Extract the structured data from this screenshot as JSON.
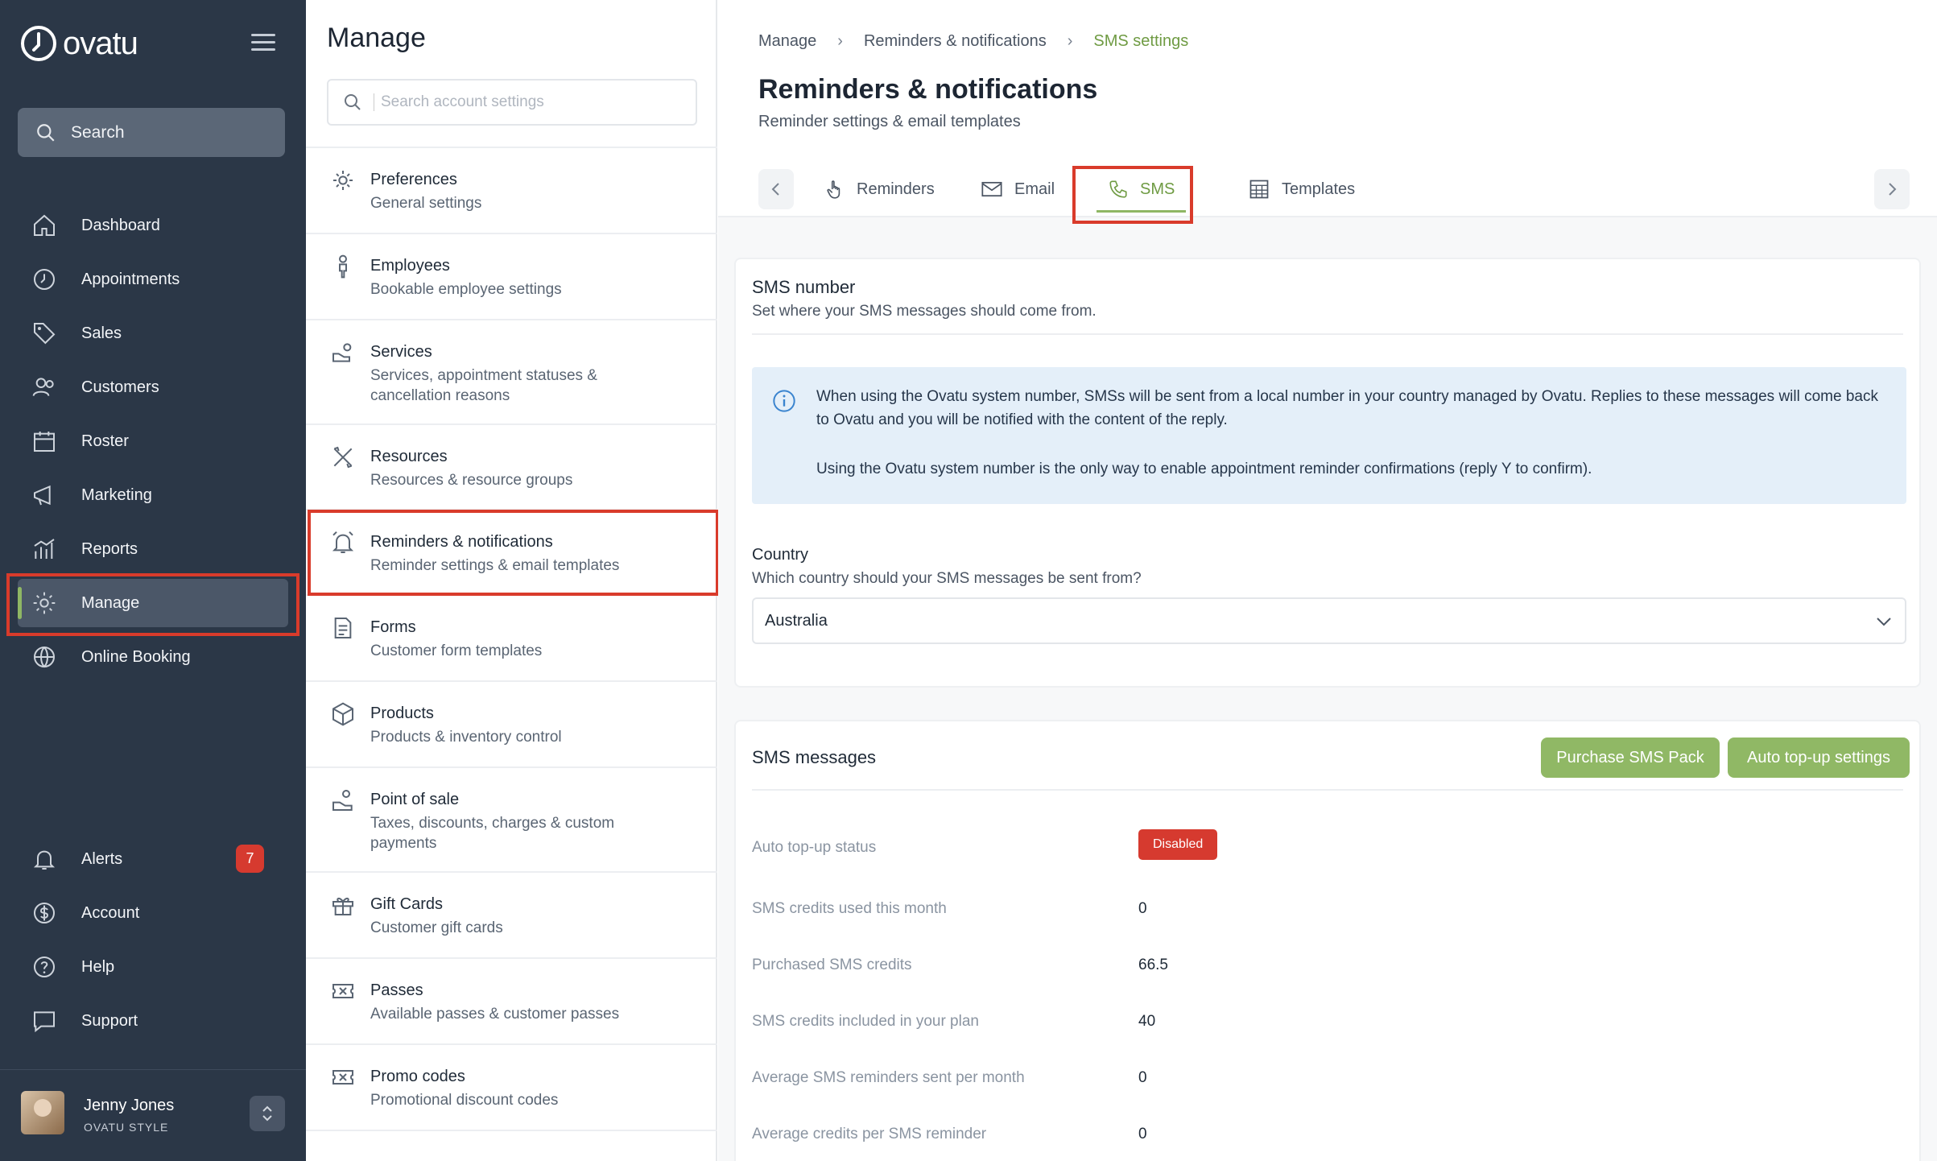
{
  "app": {
    "name": "ovatu"
  },
  "sidebar": {
    "search_label": "Search",
    "items": [
      {
        "label": "Dashboard",
        "icon": "home-icon"
      },
      {
        "label": "Appointments",
        "icon": "clock-icon"
      },
      {
        "label": "Sales",
        "icon": "tag-icon"
      },
      {
        "label": "Customers",
        "icon": "users-icon"
      },
      {
        "label": "Roster",
        "icon": "calendar-icon"
      },
      {
        "label": "Marketing",
        "icon": "megaphone-icon"
      },
      {
        "label": "Reports",
        "icon": "chart-icon"
      },
      {
        "label": "Manage",
        "icon": "gear-icon",
        "active": true
      },
      {
        "label": "Online Booking",
        "icon": "globe-icon"
      }
    ],
    "bottom_items": [
      {
        "label": "Alerts",
        "icon": "bell-icon",
        "badge": "7"
      },
      {
        "label": "Account",
        "icon": "dollar-icon"
      },
      {
        "label": "Help",
        "icon": "help-icon"
      },
      {
        "label": "Support",
        "icon": "chat-icon"
      }
    ],
    "user": {
      "name": "Jenny Jones",
      "org": "OVATU STYLE"
    },
    "accent_color": "#8fb764"
  },
  "manage": {
    "title": "Manage",
    "search_placeholder": "Search account settings",
    "items": [
      {
        "title": "Preferences",
        "subtitle": "General settings",
        "icon": "gear-icon"
      },
      {
        "title": "Employees",
        "subtitle": "Bookable employee settings",
        "icon": "person-icon"
      },
      {
        "title": "Services",
        "subtitle": "Services, appointment statuses & cancellation reasons",
        "icon": "services-icon"
      },
      {
        "title": "Resources",
        "subtitle": "Resources & resource groups",
        "icon": "tools-icon"
      },
      {
        "title": "Reminders & notifications",
        "subtitle": "Reminder settings & email templates",
        "icon": "bell-icon",
        "active": true
      },
      {
        "title": "Forms",
        "subtitle": "Customer form templates",
        "icon": "form-icon"
      },
      {
        "title": "Products",
        "subtitle": "Products & inventory control",
        "icon": "box-icon"
      },
      {
        "title": "Point of sale",
        "subtitle": "Taxes, discounts, charges & custom payments",
        "icon": "pos-icon"
      },
      {
        "title": "Gift Cards",
        "subtitle": "Customer gift cards",
        "icon": "gift-icon"
      },
      {
        "title": "Passes",
        "subtitle": "Available passes & customer passes",
        "icon": "ticket-icon"
      },
      {
        "title": "Promo codes",
        "subtitle": "Promotional discount codes",
        "icon": "ticket-icon"
      }
    ]
  },
  "main": {
    "breadcrumbs": [
      "Manage",
      "Reminders & notifications",
      "SMS settings"
    ],
    "title": "Reminders & notifications",
    "subtitle": "Reminder settings & email templates",
    "tabs": [
      {
        "label": "Reminders",
        "icon": "hand-icon"
      },
      {
        "label": "Email",
        "icon": "envelope-icon"
      },
      {
        "label": "SMS",
        "icon": "phone-icon",
        "active": true
      },
      {
        "label": "Templates",
        "icon": "table-icon"
      }
    ],
    "sms_number": {
      "title": "SMS number",
      "subtitle": "Set where your SMS messages should come from.",
      "info_line1": "When using the Ovatu system number, SMSs will be sent from a local number in your country managed by Ovatu. Replies to these messages will come back to Ovatu and you will be notified with the content of the reply.",
      "info_line2": "Using the Ovatu system number is the only way to enable appointment reminder confirmations (reply Y to confirm).",
      "country_label": "Country",
      "country_help": "Which country should your SMS messages be sent from?",
      "country_value": "Australia"
    },
    "sms_messages": {
      "title": "SMS messages",
      "purchase_button": "Purchase SMS Pack",
      "topup_button": "Auto top-up settings",
      "rows": [
        {
          "label": "Auto top-up status",
          "value": "Disabled",
          "badge": true
        },
        {
          "label": "SMS credits used this month",
          "value": "0"
        },
        {
          "label": "Purchased SMS credits",
          "value": "66.5"
        },
        {
          "label": "SMS credits included in your plan",
          "value": "40"
        },
        {
          "label": "Average SMS reminders sent per month",
          "value": "0"
        },
        {
          "label": "Average credits per SMS reminder",
          "value": "0"
        }
      ]
    }
  }
}
